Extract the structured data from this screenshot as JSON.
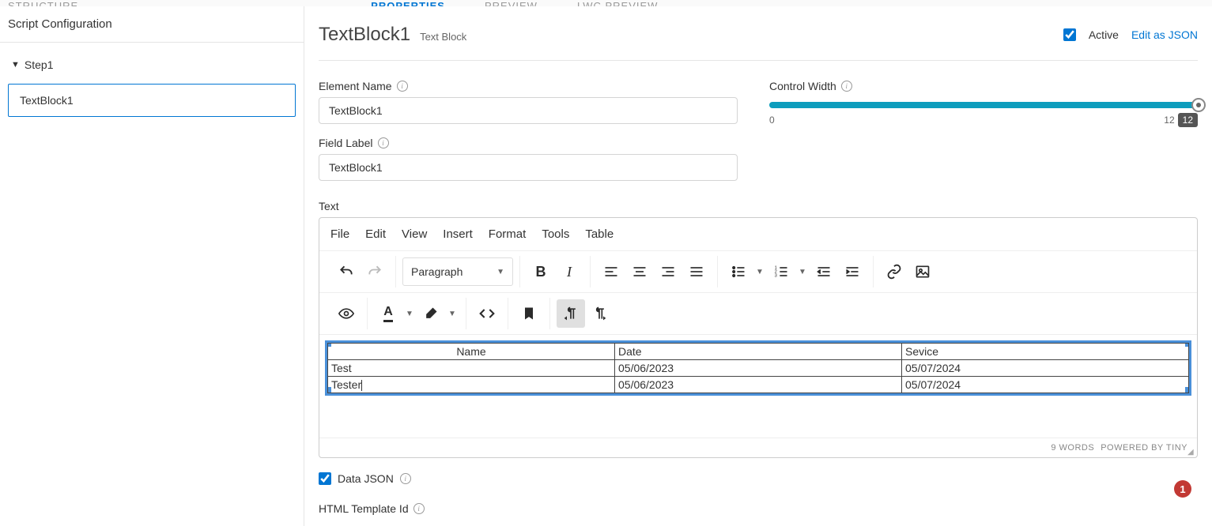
{
  "top_tabs": {
    "structure": "STRUCTURE",
    "properties": "PROPERTIES",
    "preview": "PREVIEW",
    "lwc_preview": "LWC PREVIEW"
  },
  "sidebar": {
    "title": "Script Configuration",
    "step_label": "Step1",
    "child_label": "TextBlock1"
  },
  "header": {
    "title": "TextBlock1",
    "type": "Text Block",
    "active_label": "Active",
    "edit_json": "Edit as JSON"
  },
  "fields": {
    "element_name_label": "Element Name",
    "element_name_value": "TextBlock1",
    "field_label_label": "Field Label",
    "field_label_value": "TextBlock1",
    "control_width_label": "Control Width",
    "control_width_min": "0",
    "control_width_max": "12",
    "control_width_value": "12",
    "text_label": "Text",
    "data_json_label": "Data JSON",
    "html_template_label": "HTML Template Id"
  },
  "editor": {
    "menus": {
      "file": "File",
      "edit": "Edit",
      "view": "View",
      "insert": "Insert",
      "format": "Format",
      "tools": "Tools",
      "table": "Table"
    },
    "block_format": "Paragraph",
    "table": {
      "headers": [
        "Name",
        "Date",
        "Sevice"
      ],
      "rows": [
        [
          "Test",
          "05/06/2023",
          "05/07/2024"
        ],
        [
          "Tester",
          "05/06/2023",
          "05/07/2024"
        ]
      ]
    },
    "word_count": "9 WORDS",
    "powered_by": "POWERED BY TINY",
    "badge": "1"
  }
}
